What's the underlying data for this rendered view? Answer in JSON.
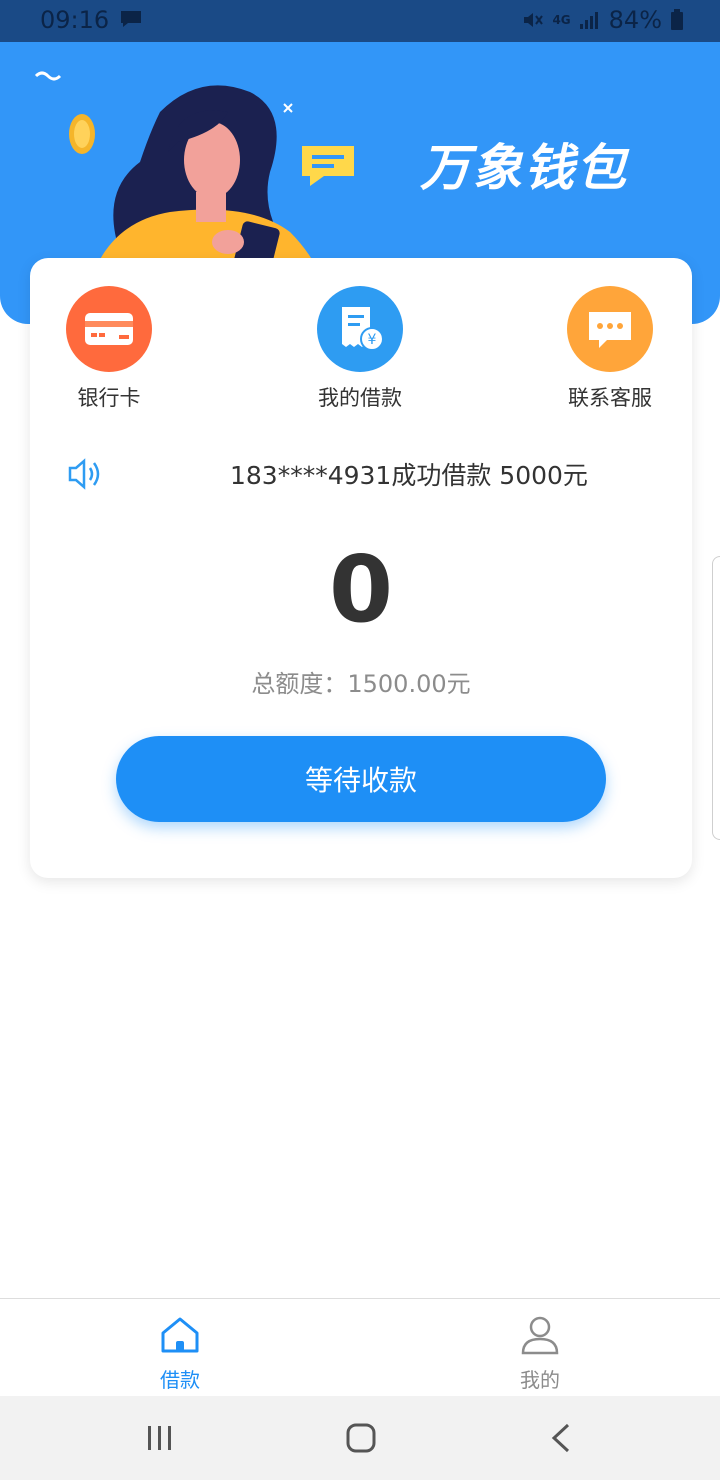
{
  "status_bar": {
    "time": "09:16",
    "network": "4G",
    "battery": "84%"
  },
  "banner": {
    "title": "万象钱包"
  },
  "quick_actions": [
    {
      "label": "银行卡",
      "icon": "bank-card-icon",
      "color": "#ff6a3d"
    },
    {
      "label": "我的借款",
      "icon": "loan-document-icon",
      "color": "#2e9cf2"
    },
    {
      "label": "联系客服",
      "icon": "chat-bubble-icon",
      "color": "#ffa53a"
    }
  ],
  "notice": {
    "icon": "speaker-icon",
    "text": "183****4931成功借款 5000元"
  },
  "loan": {
    "amount": "0",
    "total_label": "总额度：1500.00元",
    "button_label": "等待收款"
  },
  "tab_bar": {
    "items": [
      {
        "label": "借款",
        "icon": "home-icon",
        "active": true
      },
      {
        "label": "我的",
        "icon": "user-icon",
        "active": false
      }
    ],
    "active_color": "#1e8ff6",
    "inactive_color": "#8c8c8c"
  },
  "colors": {
    "accent": "#1e8ff6",
    "banner": "#3296f8"
  }
}
